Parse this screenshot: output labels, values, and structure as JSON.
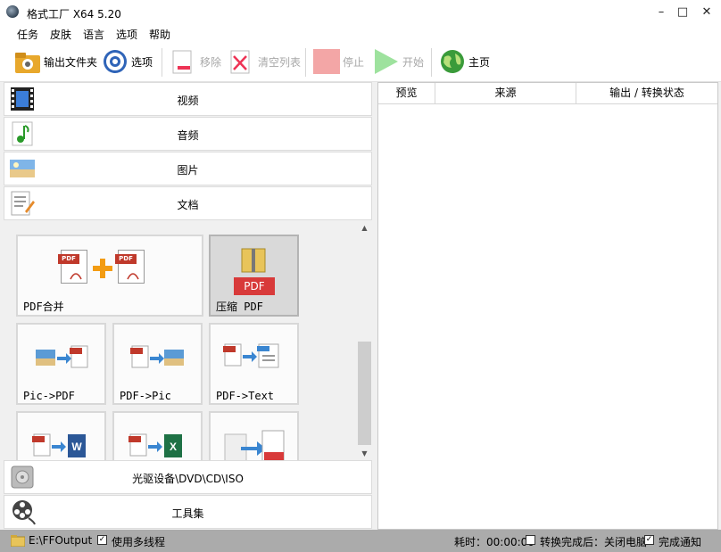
{
  "window": {
    "title": "格式工厂 X64 5.20",
    "minimize": "–",
    "maximize": "□",
    "close": "✕"
  },
  "menu": [
    "任务",
    "皮肤",
    "语言",
    "选项",
    "帮助"
  ],
  "toolbar": {
    "output_folder": "输出文件夹",
    "options": "选项",
    "remove": "移除",
    "clear_list": "清空列表",
    "stop": "停止",
    "start": "开始",
    "home": "主页"
  },
  "categories": {
    "video": "视频",
    "audio": "音频",
    "image": "图片",
    "document": "文档",
    "rom": "光驱设备\\DVD\\CD\\ISO",
    "tools": "工具集"
  },
  "tiles": [
    "PDF合并",
    "压缩 PDF",
    "Pic->PDF",
    "PDF->Pic",
    "PDF->Text",
    "",
    "",
    ""
  ],
  "table": {
    "columns": [
      "预览",
      "来源",
      "输出 / 转换状态"
    ]
  },
  "status": {
    "output_path": "E:\\FFOutput",
    "multithread": "使用多线程",
    "time": "耗时：00:00:00",
    "after_done": "转换完成后：关闭电脑",
    "notify": "完成通知"
  },
  "icons": {
    "pdf_badge": "PDF",
    "word_badge": "W",
    "excel_badge": "X"
  },
  "colors": {
    "pdf_red": "#c0392b",
    "accent_orange": "#f39c12",
    "status_bar": "#ababab"
  }
}
